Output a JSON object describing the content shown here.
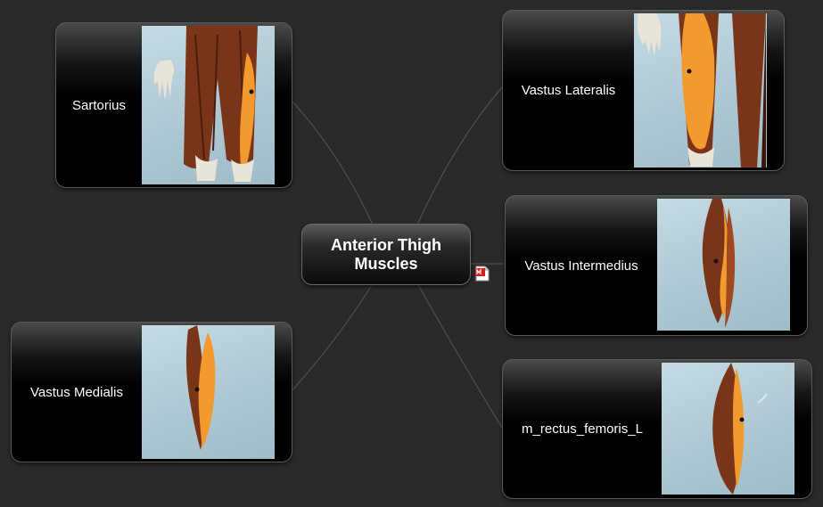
{
  "central_topic": {
    "line1": "Anterior Thigh",
    "line2": "Muscles"
  },
  "nodes": [
    {
      "label": "Sartorius"
    },
    {
      "label": "Vastus Lateralis"
    },
    {
      "label": "Vastus Intermedius"
    },
    {
      "label": "Vastus Medialis"
    },
    {
      "label": "m_rectus_femoris_L"
    }
  ],
  "colors": {
    "background": "#2a2a2a",
    "connector": "#555555",
    "muscle_highlight": "#f29a2e",
    "muscle": "#7a3418",
    "image_bg": "#b6cfd9"
  },
  "icons": {
    "attachment": "pdf-attachment-icon"
  }
}
